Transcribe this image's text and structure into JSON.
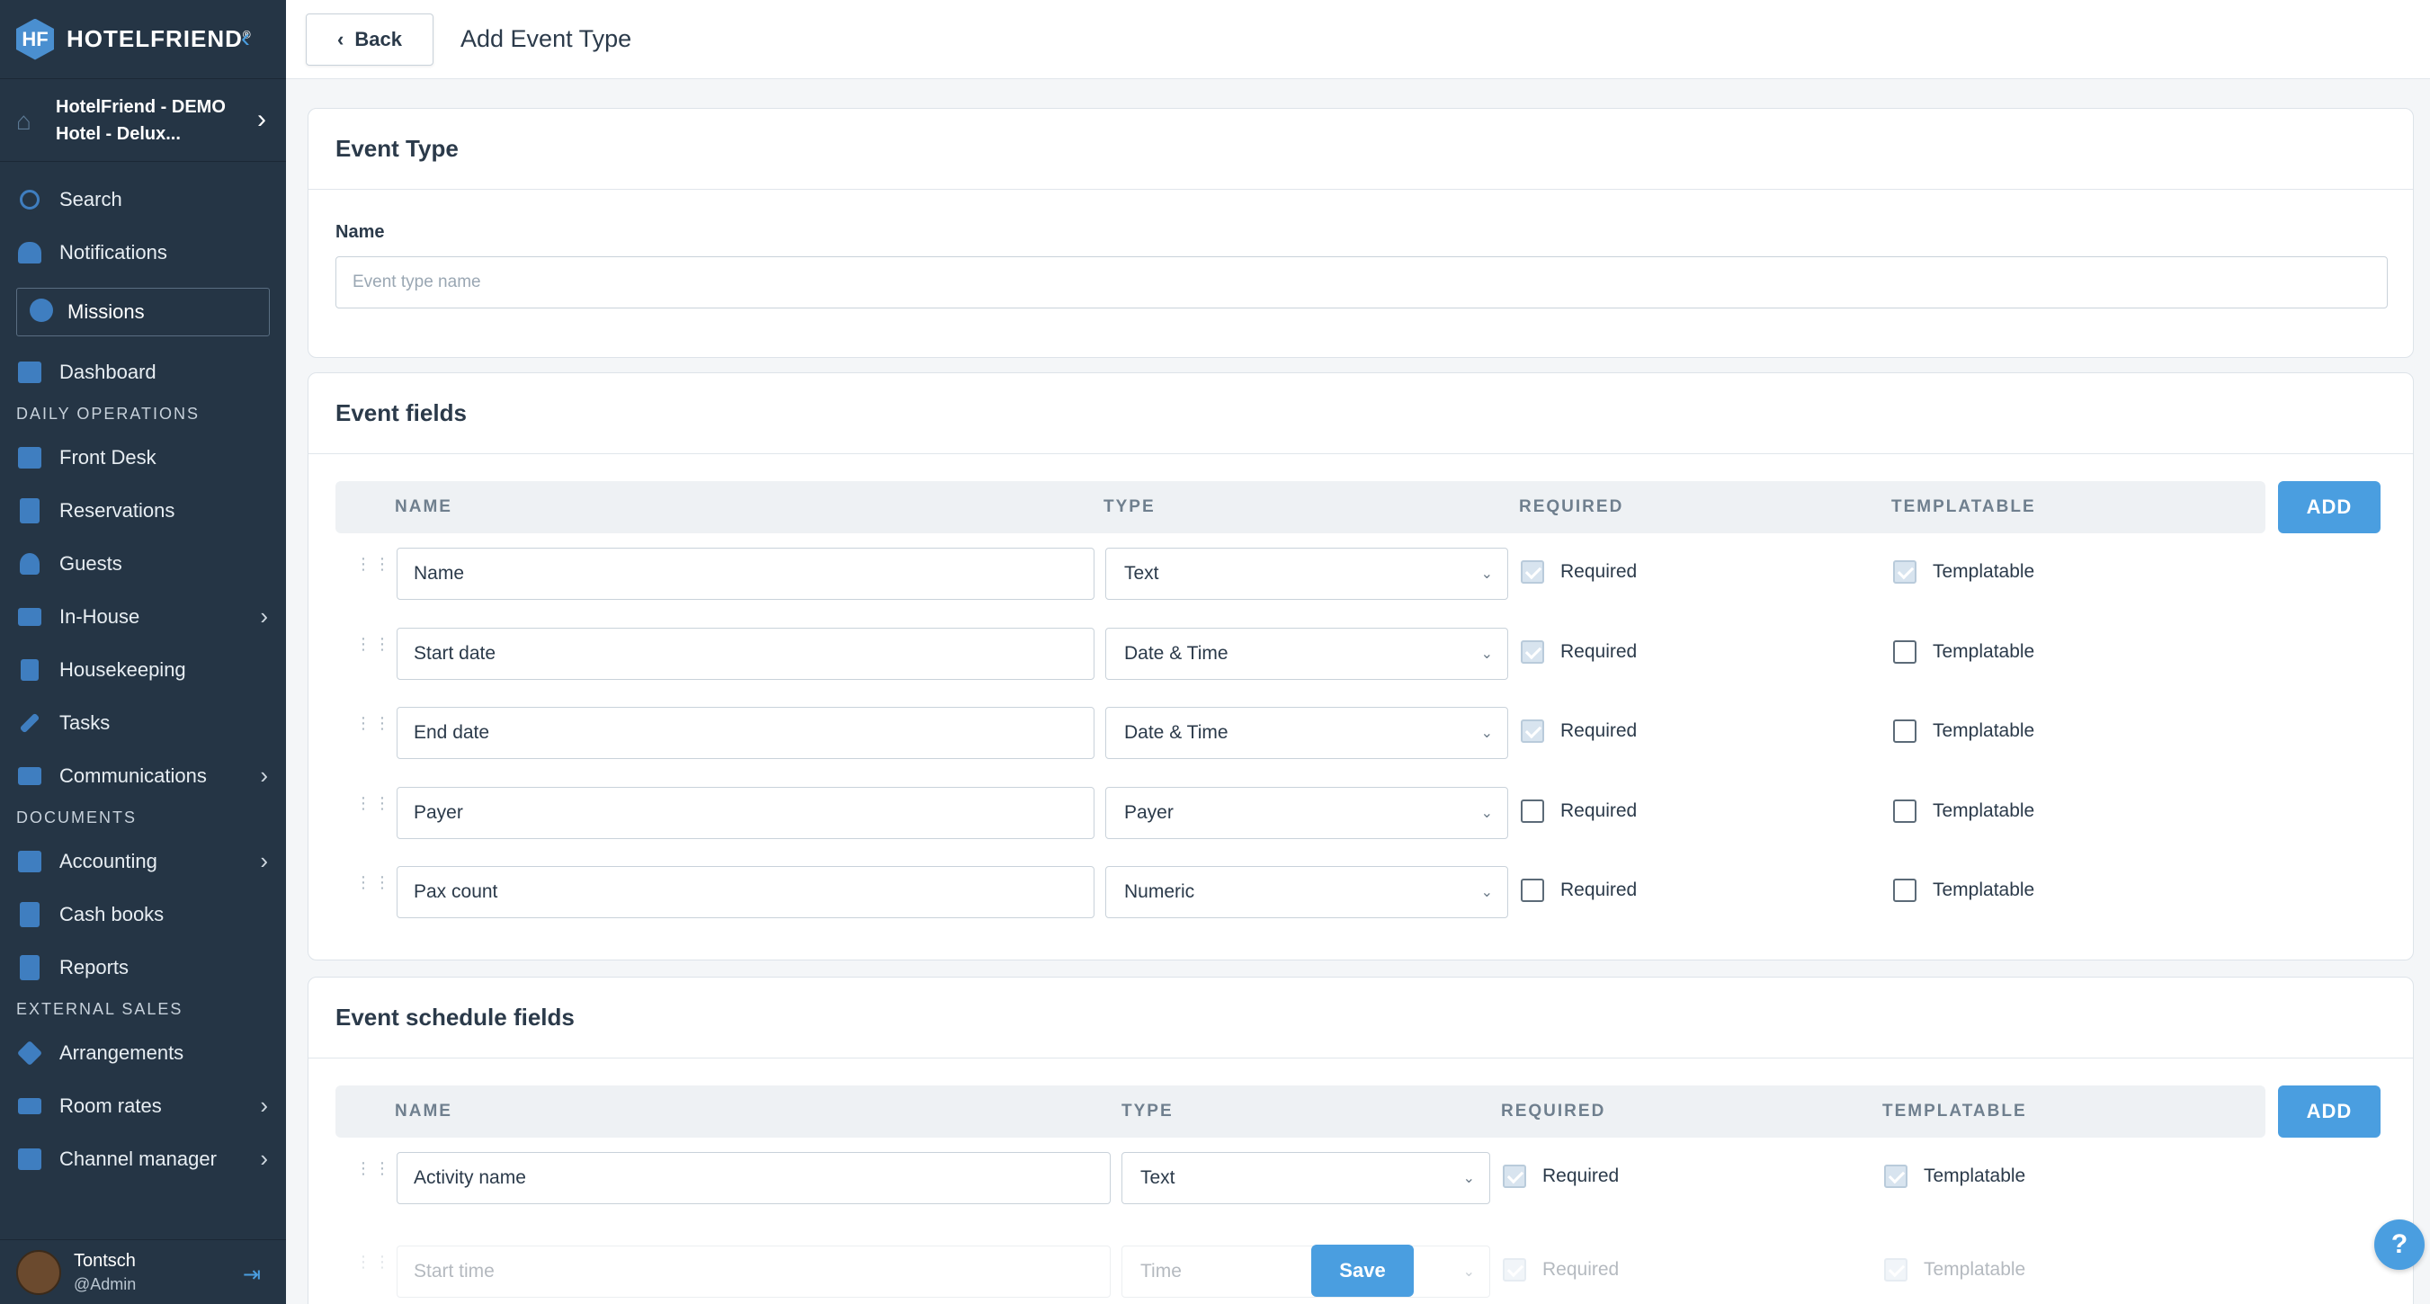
{
  "sidebar": {
    "brand": "HOTELFRIEND",
    "brand_mark": "HF",
    "hotel_name": "HotelFriend - DEMO Hotel - Delux...",
    "search": "Search",
    "notifications": "Notifications",
    "missions": "Missions",
    "dashboard": "Dashboard",
    "section_daily": "DAILY OPERATIONS",
    "front_desk": "Front Desk",
    "reservations": "Reservations",
    "guests": "Guests",
    "in_house": "In-House",
    "housekeeping": "Housekeeping",
    "tasks": "Tasks",
    "communications": "Communications",
    "section_documents": "DOCUMENTS",
    "accounting": "Accounting",
    "cash_books": "Cash books",
    "reports": "Reports",
    "section_external": "EXTERNAL SALES",
    "arrangements": "Arrangements",
    "room_rates": "Room rates",
    "channel_manager": "Channel manager",
    "user_name": "Tontsch",
    "user_role": "@Admin"
  },
  "topbar": {
    "back_label": "Back",
    "title": "Add Event Type"
  },
  "event_type": {
    "title": "Event Type",
    "name_label": "Name",
    "name_placeholder": "Event type name"
  },
  "event_fields": {
    "title": "Event fields",
    "headers": {
      "name": "NAME",
      "type": "TYPE",
      "required": "REQUIRED",
      "templatable": "TEMPLATABLE"
    },
    "add_label": "ADD",
    "rows": [
      {
        "name": "Name",
        "type": "Text",
        "required_label": "Required",
        "templatable_label": "Templatable"
      },
      {
        "name": "Start date",
        "type": "Date & Time",
        "required_label": "Required",
        "templatable_label": "Templatable"
      },
      {
        "name": "End date",
        "type": "Date & Time",
        "required_label": "Required",
        "templatable_label": "Templatable"
      },
      {
        "name": "Payer",
        "type": "Payer",
        "required_label": "Required",
        "templatable_label": "Templatable"
      },
      {
        "name": "Pax count",
        "type": "Numeric",
        "required_label": "Required",
        "templatable_label": "Templatable"
      }
    ]
  },
  "schedule_fields": {
    "title": "Event schedule fields",
    "headers": {
      "name": "NAME",
      "type": "TYPE",
      "required": "REQUIRED",
      "templatable": "TEMPLATABLE"
    },
    "add_label": "ADD",
    "rows": [
      {
        "name": "Activity name",
        "type": "Text",
        "required_label": "Required",
        "templatable_label": "Templatable"
      },
      {
        "name": "Start time",
        "type": "Time",
        "required_label": "Required",
        "templatable_label": "Templatable"
      }
    ]
  },
  "save_label": "Save",
  "help_label": "?"
}
